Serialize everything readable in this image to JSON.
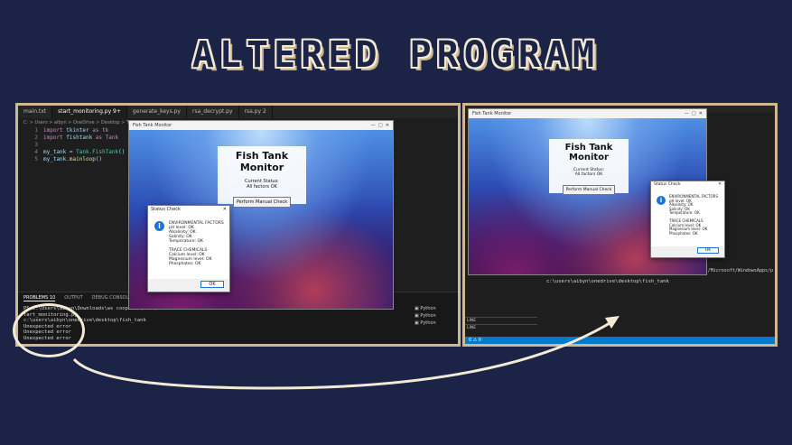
{
  "banner": "ALTERED PROGRAM",
  "left": {
    "tabs": [
      "main.txt",
      "start_monitoring.py 9+",
      "generate_keys.py",
      "rsa_decrypt.py",
      "rsa.py"
    ],
    "tab_count": "2",
    "breadcrumb": "C: > Users > aibyn > OneDrive > Desktop > Tell",
    "code": [
      {
        "n": "1",
        "a": "import ",
        "b": "tkinter",
        "c": " as tk"
      },
      {
        "n": "2",
        "a": "import ",
        "b": "fishtank",
        "c": " as Tank"
      },
      {
        "n": "3",
        "a": "",
        "b": "",
        "c": ""
      },
      {
        "n": "4",
        "a": "my_tank = ",
        "b": "Tank.FishTank",
        "c": "()"
      },
      {
        "n": "5",
        "a": "my_tank.",
        "b": "mainloop",
        "c": "()"
      }
    ],
    "panel_tabs": [
      "PROBLEMS",
      "OUTPUT",
      "DEBUG CONSOLE"
    ],
    "problems_count": "10",
    "terminal": [
      "PS C:\\Users\\aibyn\\Downloads\\ws coops & \\conk/s",
      "tart_monitoring.py",
      "c:\\users\\aibyn\\onedrive\\desktop\\fish_tank",
      "Unexpected error",
      "Unexpected error",
      "Unexpected error"
    ],
    "terminal_sessions": [
      "Python",
      "Python",
      "Python"
    ],
    "terminal_right": "conk/s"
  },
  "app_left": {
    "title": "Fish Tank Monitor",
    "heading": "Fish Tank Monitor",
    "status_label": "Current Status:",
    "status_value": "All factors OK",
    "button": "Perform Manual Check",
    "dialog": {
      "title": "Status Check",
      "lines": [
        "ENVIRONMENTAL FACTORS",
        "pH level: OK",
        "Alkalinity: OK",
        "Salinity: OK",
        "Temperature: OK",
        "",
        "TRACE CHEMICALS",
        "Calcium level: OK",
        "Magnesium level: OK",
        "Phosphates: OK"
      ],
      "ok": "OK"
    }
  },
  "right": {
    "terminal": [
      "c:\\users\\aibyn\\onedrive\\desktop\\fish_tank"
    ],
    "right_path": "ocal/Microsoft/WindowsApps/p",
    "bottom_labels": [
      "LINE",
      "LINE"
    ],
    "status_bar": "0 ⚠ 0"
  },
  "app_right": {
    "title": "Fish Tank Monitor",
    "heading": "Fish Tank Monitor",
    "status_label": "Current Status:",
    "status_value": "All factors OK",
    "button": "Perform Manual Check",
    "dialog": {
      "title": "Status Check",
      "lines": [
        "ENVIRONMENTAL FACTORS",
        "pH level: OK",
        "Alkalinity: OK",
        "Salinity: OK",
        "Temperature: OK",
        "",
        "TRACE CHEMICALS",
        "Calcium level: OK",
        "Magnesium level: OK",
        "Phosphates: OK"
      ],
      "ok": "OK"
    }
  },
  "colors": {
    "background": "#1b2347",
    "frame": "#cdb892",
    "accent": "#1e73d6"
  }
}
